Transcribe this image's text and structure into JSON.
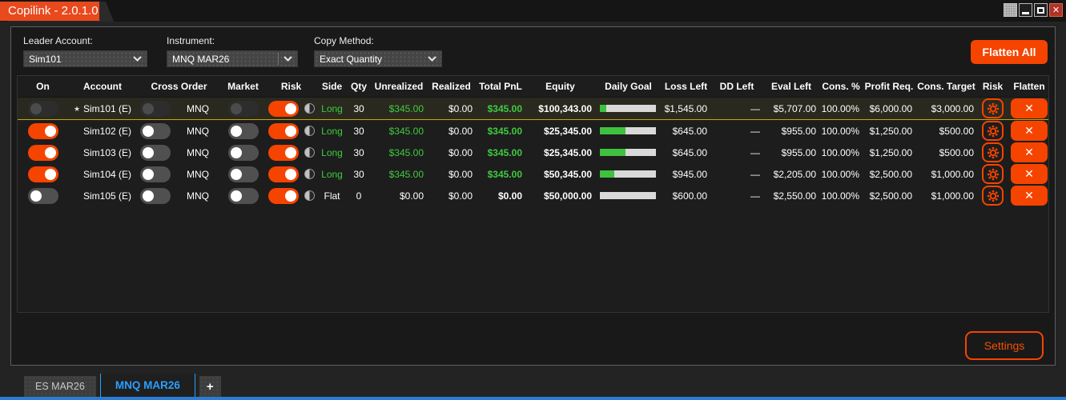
{
  "window": {
    "title": "Copilink - 2.0.1.0",
    "controls": {
      "texture": "texture-button",
      "minimize": "minimize-button",
      "maximize": "maximize-button",
      "close": "close-button",
      "close_glyph": "✕"
    }
  },
  "toolbar": {
    "leader_account": {
      "label": "Leader Account:",
      "value": "Sim101"
    },
    "instrument": {
      "label": "Instrument:",
      "value": "MNQ MAR26"
    },
    "copy_method": {
      "label": "Copy Method:",
      "value": "Exact Quantity"
    },
    "flatten_all_label": "Flatten All"
  },
  "table": {
    "columns": [
      "On",
      "Account",
      "Cross Order",
      "Market",
      "Risk",
      "Side",
      "Qty",
      "Unrealized",
      "Realized",
      "Total PnL",
      "Equity",
      "Daily Goal",
      "Loss Left",
      "DD Left",
      "Eval Left",
      "Cons. %",
      "Profit Req.",
      "Cons. Target",
      "Risk",
      "Flatten"
    ],
    "rows": [
      {
        "on": "disabled",
        "account": "Sim101 (E)",
        "leader": true,
        "cross": "disabled",
        "cross_instrument": "MNQ",
        "market": "disabled",
        "risk": "on",
        "side": "Long",
        "side_green": true,
        "qty": "30",
        "unrealized": "$345.00",
        "unrealized_green": true,
        "realized": "$0.00",
        "total_pnl": "$345.00",
        "total_green": true,
        "equity": "$100,343.00",
        "daily_goal_pct": 12,
        "loss_left": "$1,545.00",
        "dd_left": "—",
        "eval_left": "$5,707.00",
        "cons_pct": "100.00%",
        "profit_req": "$6,000.00",
        "cons_target": "$3,000.00",
        "selected": true
      },
      {
        "on": "on",
        "account": "Sim102 (E)",
        "leader": false,
        "cross": "off",
        "cross_instrument": "MNQ",
        "market": "off",
        "risk": "on",
        "side": "Long",
        "side_green": true,
        "qty": "30",
        "unrealized": "$345.00",
        "unrealized_green": true,
        "realized": "$0.00",
        "total_pnl": "$345.00",
        "total_green": true,
        "equity": "$25,345.00",
        "daily_goal_pct": 45,
        "loss_left": "$645.00",
        "dd_left": "—",
        "eval_left": "$955.00",
        "cons_pct": "100.00%",
        "profit_req": "$1,250.00",
        "cons_target": "$500.00",
        "selected": false
      },
      {
        "on": "on",
        "account": "Sim103 (E)",
        "leader": false,
        "cross": "off",
        "cross_instrument": "MNQ",
        "market": "off",
        "risk": "on",
        "side": "Long",
        "side_green": true,
        "qty": "30",
        "unrealized": "$345.00",
        "unrealized_green": true,
        "realized": "$0.00",
        "total_pnl": "$345.00",
        "total_green": true,
        "equity": "$25,345.00",
        "daily_goal_pct": 45,
        "loss_left": "$645.00",
        "dd_left": "—",
        "eval_left": "$955.00",
        "cons_pct": "100.00%",
        "profit_req": "$1,250.00",
        "cons_target": "$500.00",
        "selected": false
      },
      {
        "on": "on",
        "account": "Sim104 (E)",
        "leader": false,
        "cross": "off",
        "cross_instrument": "MNQ",
        "market": "off",
        "risk": "on",
        "side": "Long",
        "side_green": true,
        "qty": "30",
        "unrealized": "$345.00",
        "unrealized_green": true,
        "realized": "$0.00",
        "total_pnl": "$345.00",
        "total_green": true,
        "equity": "$50,345.00",
        "daily_goal_pct": 25,
        "loss_left": "$945.00",
        "dd_left": "—",
        "eval_left": "$2,205.00",
        "cons_pct": "100.00%",
        "profit_req": "$2,500.00",
        "cons_target": "$1,000.00",
        "selected": false
      },
      {
        "on": "off",
        "account": "Sim105 (E)",
        "leader": false,
        "cross": "off",
        "cross_instrument": "MNQ",
        "market": "off",
        "risk": "on",
        "side": "Flat",
        "side_green": false,
        "qty": "0",
        "unrealized": "$0.00",
        "unrealized_green": false,
        "realized": "$0.00",
        "total_pnl": "$0.00",
        "total_green": false,
        "equity": "$50,000.00",
        "daily_goal_pct": 0,
        "loss_left": "$600.00",
        "dd_left": "—",
        "eval_left": "$2,550.00",
        "cons_pct": "100.00%",
        "profit_req": "$2,500.00",
        "cons_target": "$1,000.00",
        "selected": false
      }
    ],
    "row_icons": {
      "leader_star": "★",
      "flatten_x": "✕"
    }
  },
  "settings_label": "Settings",
  "bottom_tabs": [
    {
      "label": "ES MAR26",
      "active": false
    },
    {
      "label": "MNQ MAR26",
      "active": true
    },
    {
      "label": "+",
      "active": false
    }
  ],
  "colors": {
    "accent_orange": "#f54400",
    "title_orange": "#e8491d",
    "positive_green": "#3fcb3f",
    "selected_row_border": "#c9a800",
    "active_tab_blue": "#2a9fff",
    "bottom_strip_blue": "#2c7bd4",
    "close_button_red": "#b13327",
    "progress_fill": "#3ec13e"
  }
}
